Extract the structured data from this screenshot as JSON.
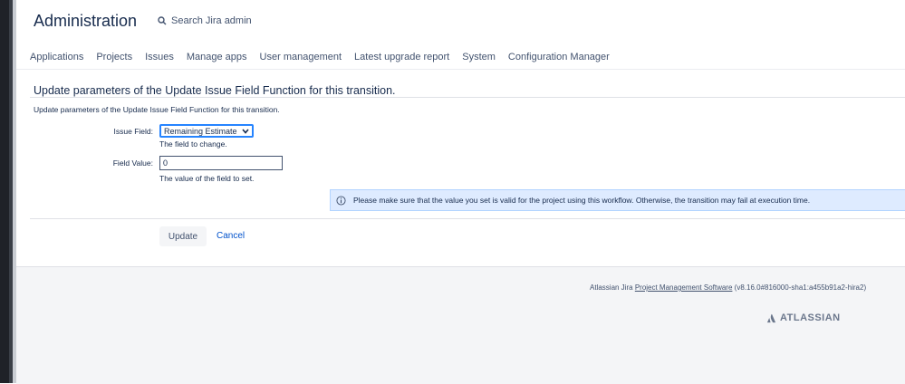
{
  "header": {
    "title": "Administration",
    "search_label": "Search Jira admin"
  },
  "nav": {
    "items": [
      "Applications",
      "Projects",
      "Issues",
      "Manage apps",
      "User management",
      "Latest upgrade report",
      "System",
      "Configuration Manager"
    ]
  },
  "form": {
    "heading": "Update parameters of the Update Issue Field Function for this transition.",
    "description": "Update parameters of the Update Issue Field Function for this transition.",
    "issue_field_label": "Issue Field:",
    "issue_field_value": "Remaining Estimate",
    "issue_field_help": "The field to change.",
    "field_value_label": "Field Value:",
    "field_value_value": "0",
    "field_value_help": "The value of the field to set.",
    "info_message": "Please make sure that the value you set is valid for the project using this workflow. Otherwise, the transition may fail at execution time.",
    "update_label": "Update",
    "cancel_label": "Cancel"
  },
  "footer": {
    "prefix": "Atlassian Jira",
    "link": "Project Management Software",
    "version": "(v8.16.0#816000-sha1:a455b91a2-hira2)",
    "brand": "ATLASSIAN"
  },
  "colors": {
    "link": "#0052CC",
    "info_bg": "#deebff",
    "focus": "#2684ff"
  }
}
